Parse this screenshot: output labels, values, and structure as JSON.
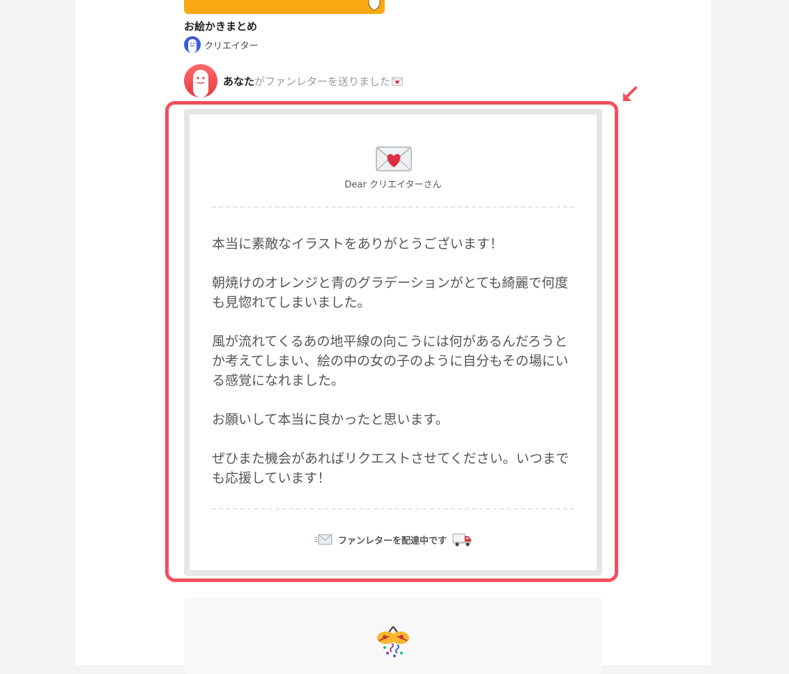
{
  "work": {
    "title": "お絵かきまとめ",
    "creator_name": "クリエイター"
  },
  "activity": {
    "actor": "あなた",
    "action_text": "がファンレターを送りました"
  },
  "letter": {
    "salutation": "Dear クリエイターさん",
    "paragraphs": [
      "本当に素敵なイラストをありがとうございます！",
      "朝焼けのオレンジと青のグラデーションがとても綺麗で何度も見惚れてしまいました。",
      "風が流れてくるあの地平線の向こうには何があるんだろうとか考えてしまい、絵の中の女の子のように自分もその場にいる感覚になれました。",
      "お願いして本当に良かったと思います。",
      "ぜひまた機会があればリクエストさせてください。いつまでも応援しています！"
    ],
    "status": "ファンレターを配達中です"
  },
  "colors": {
    "accent_red": "#f24e5c",
    "card_orange": "#f9a90f",
    "creator_blue": "#3b5bdb"
  },
  "icons": {
    "letter": "love-letter-icon",
    "delivery": "delivery-truck-icon",
    "celebration": "party-popper-icon"
  }
}
